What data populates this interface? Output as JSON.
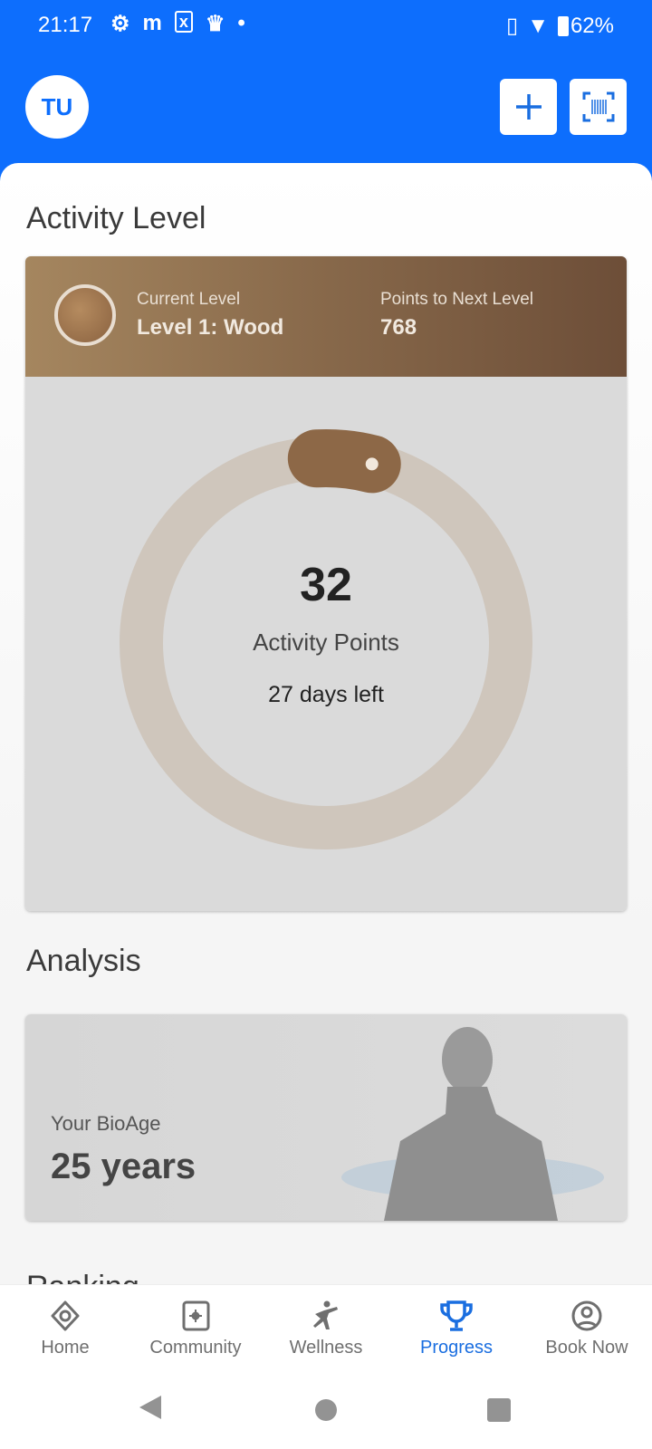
{
  "status_bar": {
    "time": "21:17",
    "notification_icons": [
      "gear-icon",
      "m-icon",
      "sim-icon",
      "crown-icon",
      "dot-icon"
    ],
    "battery": "62%"
  },
  "header": {
    "avatar_initials": "TU",
    "add_icon": "plus-icon",
    "scan_icon": "barcode-scan-icon"
  },
  "colors": {
    "brand": "#0d6efd",
    "active_nav": "#1a6ee0",
    "wood": "#8a6b4c"
  },
  "activity": {
    "title": "Activity Level",
    "current_level_label": "Current Level",
    "current_level": "Level 1: Wood",
    "next_label": "Points to Next Level",
    "next_points": "768",
    "points": "32",
    "points_label": "Activity Points",
    "days_left": "27 days left",
    "progress_fraction": 0.04
  },
  "analysis": {
    "title": "Analysis",
    "bioage_label": "Your BioAge",
    "bioage_value": "25 years"
  },
  "next_section_title": "Ranking",
  "nav": {
    "items": [
      {
        "label": "Home",
        "icon": "home-diamond-icon"
      },
      {
        "label": "Community",
        "icon": "community-icon"
      },
      {
        "label": "Wellness",
        "icon": "wellness-icon"
      },
      {
        "label": "Progress",
        "icon": "trophy-icon",
        "active": true
      },
      {
        "label": "Book Now",
        "icon": "account-circle-icon"
      }
    ]
  }
}
